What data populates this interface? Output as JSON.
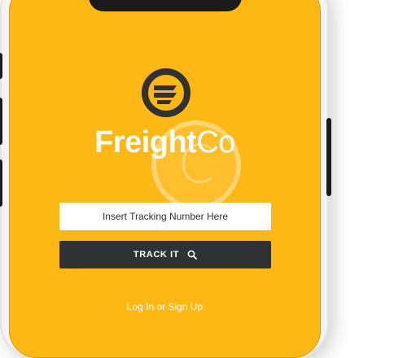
{
  "app": {
    "brand_bold": "Freight",
    "brand_light": "Co"
  },
  "colors": {
    "screen_background": "#fdb813",
    "button_background": "#2f3133",
    "text_white": "#ffffff"
  },
  "icons": {
    "logo": "freightco-logo-icon",
    "search": "search-icon",
    "watermark": "copyright-watermark-icon"
  },
  "tracking": {
    "placeholder": "Insert Tracking Number Here",
    "value": ""
  },
  "track_button": {
    "label": "TRACK IT"
  },
  "auth": {
    "login_label": "Log In",
    "separator": "or",
    "signup_label": "Sign Up"
  },
  "watermark": {
    "symbol": "C"
  }
}
